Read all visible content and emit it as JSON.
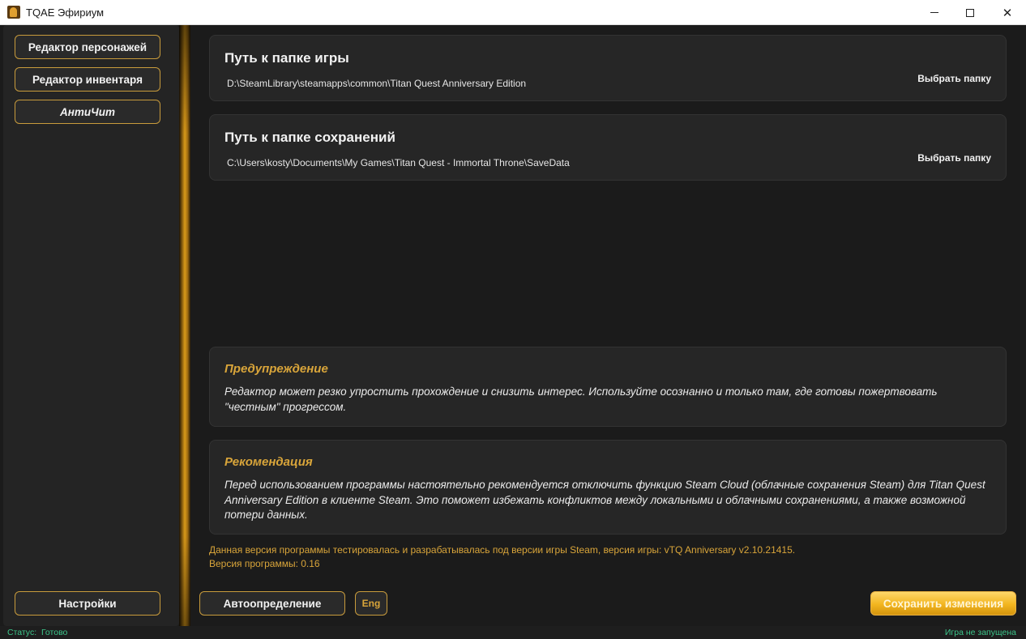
{
  "window": {
    "title": "TQAE Эфириум",
    "minimize": "minimize",
    "maximize": "maximize",
    "close": "close"
  },
  "sidebar": {
    "items": [
      {
        "label": "Редактор персонажей"
      },
      {
        "label": "Редактор инвентаря"
      },
      {
        "label": "АнтиЧит"
      }
    ],
    "settings_label": "Настройки"
  },
  "game_folder": {
    "title": "Путь к папке игры",
    "path": "D:\\SteamLibrary\\steamapps\\common\\Titan Quest Anniversary Edition",
    "choose_label": "Выбрать папку"
  },
  "save_folder": {
    "title": "Путь к папке сохранений",
    "path": "C:\\Users\\kosty\\Documents\\My Games\\Titan Quest - Immortal Throne\\SaveData",
    "choose_label": "Выбрать папку"
  },
  "warning": {
    "title": "Предупреждение",
    "body": "Редактор может резко упростить прохождение и снизить интерес. Используйте осознанно и только там, где готовы пожертвовать \"честным\" прогрессом."
  },
  "recommendation": {
    "title": "Рекомендация",
    "body": "Перед использованием программы настоятельно рекомендуется отключить функцию Steam Cloud (облачные сохранения Steam) для Titan Quest Anniversary Edition в клиенте Steam. Это поможет избежать конфликтов между локальными и облачными сохранениями, а также возможной потери данных."
  },
  "version_info": {
    "tested_text": "Данная версия программы тестировалась и разрабатывалась под версии игры Steam, версия игры: vTQ Anniversary v2.10.21415.",
    "program_version": "Версия программы: 0.16"
  },
  "buttons": {
    "autodetect": "Автоопределение",
    "language": "Eng",
    "save": "Сохранить изменения"
  },
  "status": {
    "left_label": "Статус:",
    "left_value": "Готово",
    "right": "Игра не запущена"
  },
  "colors": {
    "accent_gold": "#d9a53a",
    "status_green": "#3cc48a",
    "background": "#1b1b1b"
  }
}
